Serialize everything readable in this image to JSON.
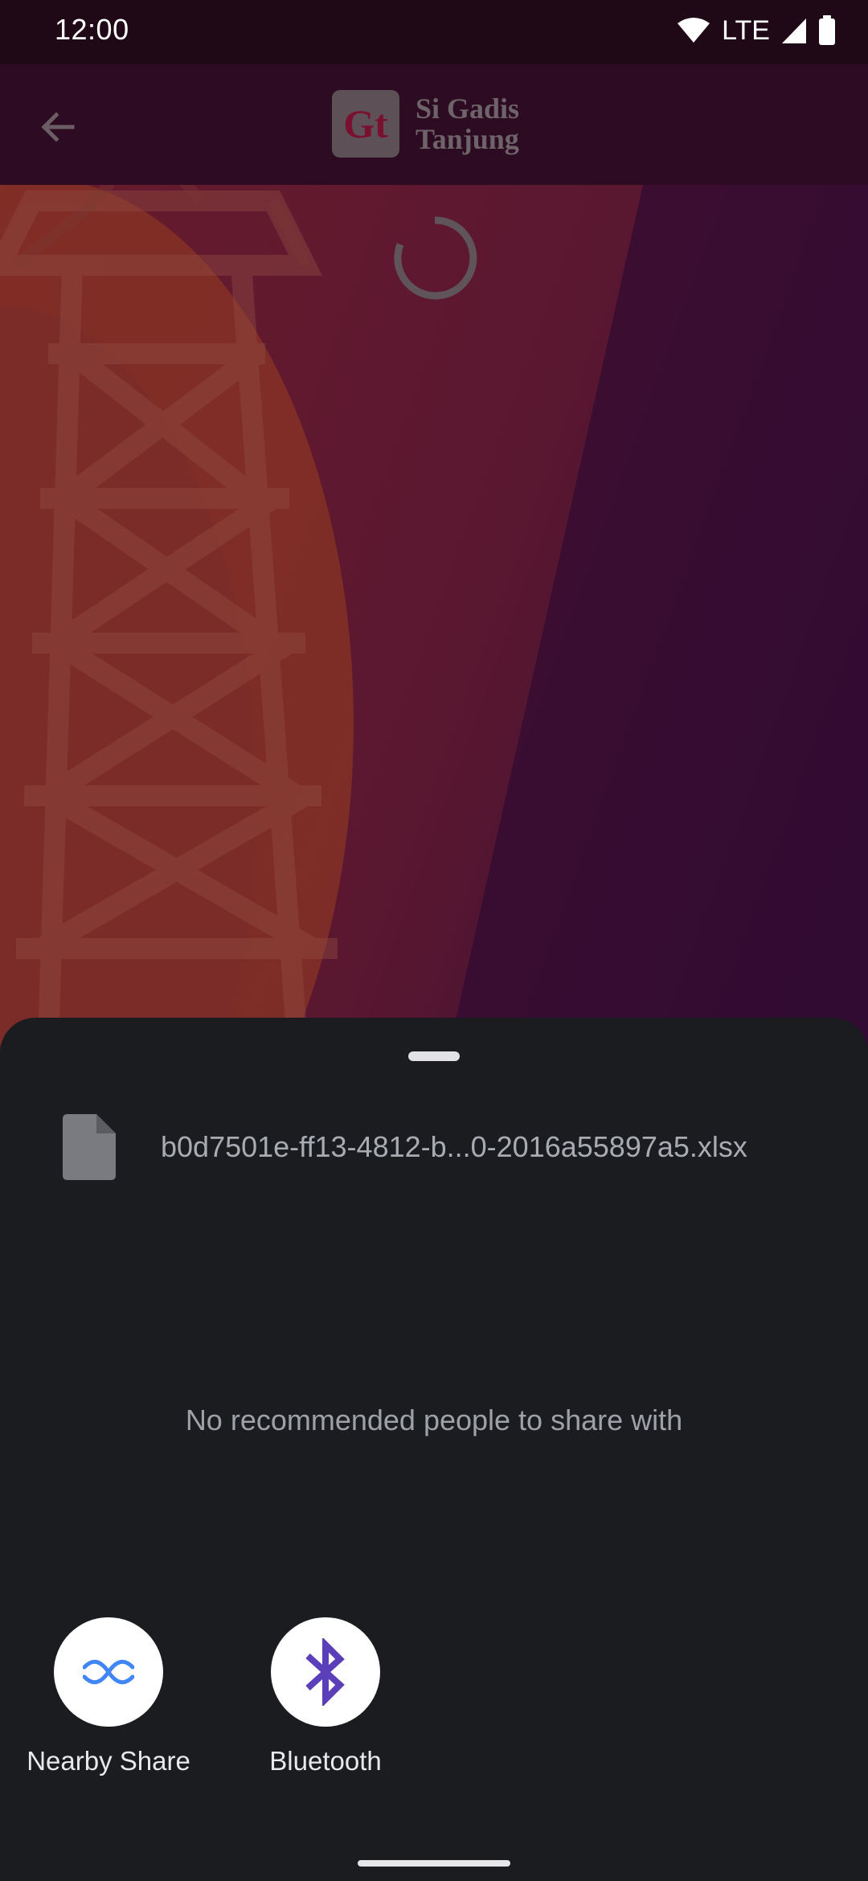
{
  "status_bar": {
    "time": "12:00",
    "network": "LTE",
    "icons": [
      "wifi-icon",
      "cellular-signal-icon",
      "battery-icon"
    ]
  },
  "app": {
    "logo_mark": "Gt",
    "logo_line1": "Si Gadis",
    "logo_line2": "Tanjung",
    "icons": [
      "back-arrow-icon"
    ],
    "state": "loading"
  },
  "share_sheet": {
    "file_name": "b0d7501e-ff13-4812-b...0-2016a55897a5.xlsx",
    "file_icon": "file-icon",
    "empty_message": "No recommended people to share with",
    "targets": [
      {
        "label": "Nearby Share",
        "icon": "nearby-share-icon",
        "color": "#4285f4"
      },
      {
        "label": "Bluetooth",
        "icon": "bluetooth-icon",
        "color": "#5b3fb8"
      }
    ]
  },
  "colors": {
    "sheet_background": "#1b1c20",
    "status_bar": "#1f0916"
  }
}
